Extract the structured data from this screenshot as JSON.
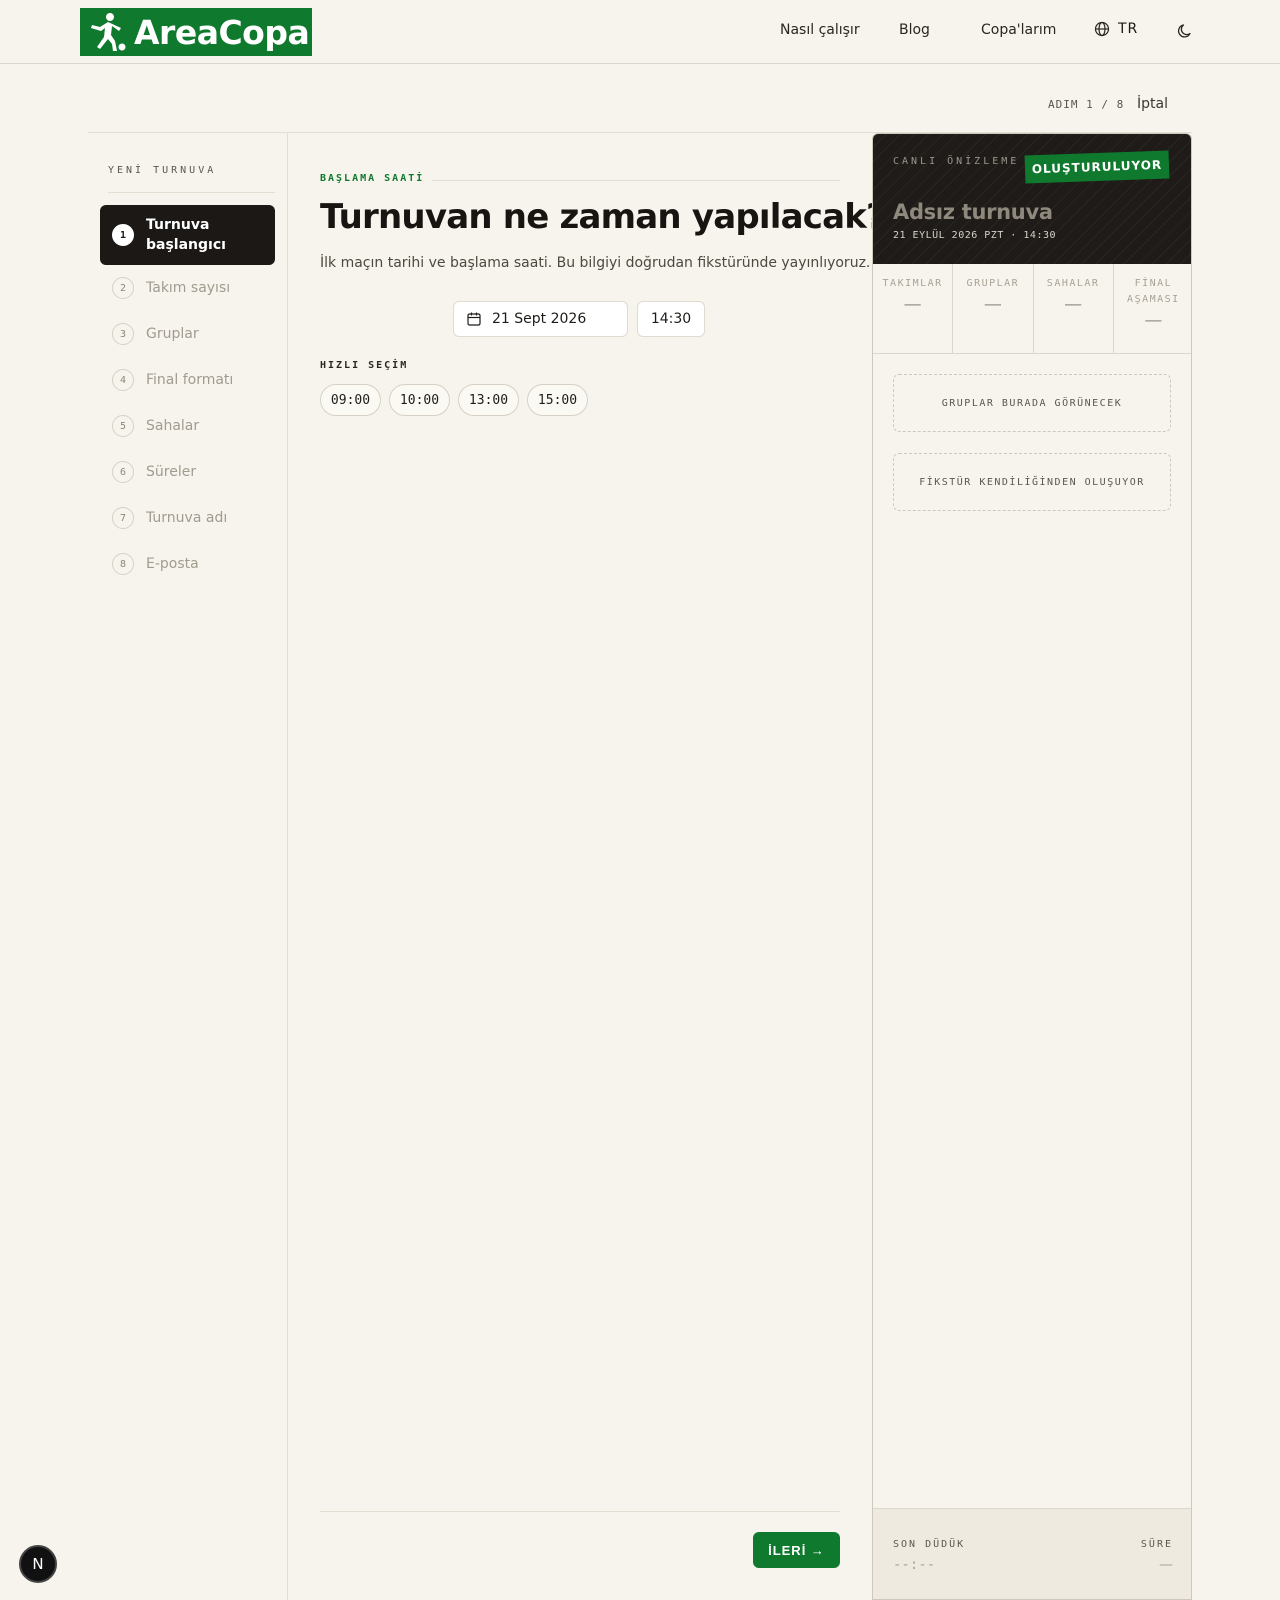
{
  "header": {
    "brand": "AreaCopa",
    "nav": [
      "Nasıl çalışır",
      "Blog",
      "Copa'larım"
    ],
    "language": "TR",
    "icons": {
      "language": "globe-icon",
      "theme": "moon-icon"
    }
  },
  "wizard": {
    "step_counter": "ADIM 1 / 8",
    "cancel_label": "İptal"
  },
  "sidebar": {
    "title": "YENİ TURNUVA",
    "active_index": 0,
    "steps": [
      {
        "num": "1",
        "label": "Turnuva başlangıcı"
      },
      {
        "num": "2",
        "label": "Takım sayısı"
      },
      {
        "num": "3",
        "label": "Gruplar"
      },
      {
        "num": "4",
        "label": "Final formatı"
      },
      {
        "num": "5",
        "label": "Sahalar"
      },
      {
        "num": "6",
        "label": "Süreler"
      },
      {
        "num": "7",
        "label": "Turnuva adı"
      },
      {
        "num": "8",
        "label": "E-posta"
      }
    ]
  },
  "main": {
    "eyebrow": "BAŞLAMA SAATİ",
    "title": "Turnuvan ne zaman yapılacak?",
    "description": "İlk maçın tarihi ve başlama saati. Bu bilgiyi doğrudan fikstüründe yayınlıyoruz.",
    "date_value": "21 Sept 2026",
    "time_value": "14:30",
    "quick_label": "HIZLI SEÇİM",
    "quick_times": [
      "09:00",
      "10:00",
      "13:00",
      "15:00"
    ],
    "next_label": "İLERİ →"
  },
  "preview": {
    "live_label": "CANLI ÖNİZLEME",
    "badge": "OLUŞTURULUYOR",
    "title": "Adsız turnuva",
    "date_line": "21 EYLÜL 2026 PZT · 14:30",
    "stats": [
      {
        "label": "TAKIMLAR",
        "value": "—"
      },
      {
        "label": "GRUPLAR",
        "value": "—"
      },
      {
        "label": "SAHALAR",
        "value": "—"
      },
      {
        "label": "FİNAL AŞAMASI",
        "value": "—"
      }
    ],
    "groups_placeholder": "GRUPLAR BURADA GÖRÜNECEK",
    "fixture_placeholder": "FİKSTÜR KENDİLİĞİNDEN OLUŞUYOR",
    "footer_left_label": "SON DÜDÜK",
    "footer_left_value": "--:--",
    "footer_right_label": "SÜRE",
    "footer_right_value": "—"
  },
  "dev_badge": "N",
  "colors": {
    "brand_green": "#0f7a2e",
    "background": "#f7f4ed",
    "dark": "#1b1815"
  }
}
